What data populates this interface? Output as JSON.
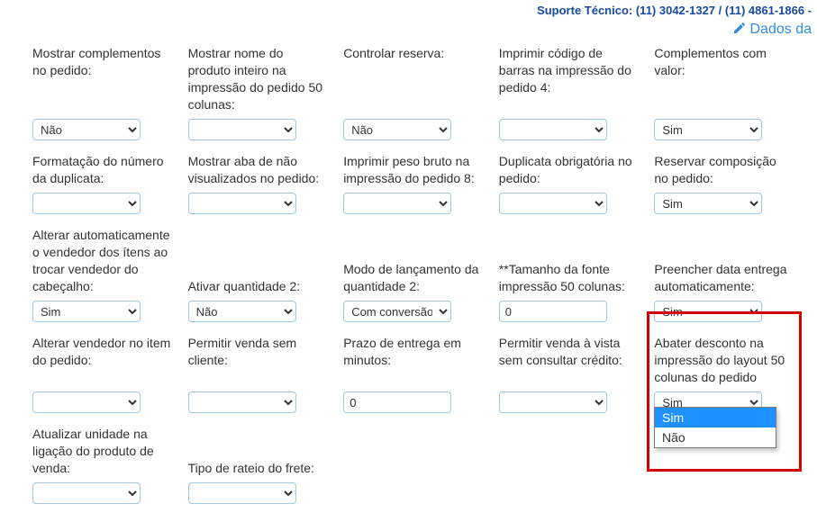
{
  "topbar": {
    "support_text": "Suporte Técnico: (11) 3042-1327 / (11) 4861-1866 -"
  },
  "editlink": {
    "text": "Dados da"
  },
  "options": {
    "sim": "Sim",
    "nao": "Não",
    "com_conversao": "Com conversão"
  },
  "dropdown_open": {
    "opt1": "Sim",
    "opt2": "Não"
  },
  "fields": {
    "r1c1": {
      "label": "Mostrar complementos no pedido:",
      "value": "Não"
    },
    "r1c2": {
      "label": "Mostrar nome do produto inteiro na impressão do pedido 50 colunas:",
      "value": ""
    },
    "r1c3": {
      "label": "Controlar reserva:",
      "value": "Não"
    },
    "r1c4": {
      "label": "Imprimir código de barras na impressão do pedido 4:",
      "value": ""
    },
    "r1c5": {
      "label": "Complementos com valor:",
      "value": "Sim"
    },
    "r2c1": {
      "label": "Formatação do número da duplicata:",
      "value": ""
    },
    "r2c2": {
      "label": "Mostrar aba de não visualizados no pedido:",
      "value": ""
    },
    "r2c3": {
      "label": "Imprimir peso bruto na impressão do pedido 8:",
      "value": ""
    },
    "r2c4": {
      "label": "Duplicata obrigatória no pedido:",
      "value": ""
    },
    "r2c5": {
      "label": "Reservar composição no pedido:",
      "value": "Sim"
    },
    "r3c1": {
      "label": "Alterar automaticamente o vendedor dos ítens ao trocar vendedor do cabeçalho:",
      "value": "Sim"
    },
    "r3c2": {
      "label": "Ativar quantidade 2:",
      "value": "Não"
    },
    "r3c3": {
      "label": "Modo de lançamento da quantidade 2:",
      "value": "Com conversão"
    },
    "r3c4": {
      "label": "**Tamanho da fonte impressão 50 colunas:",
      "value": "0"
    },
    "r3c5": {
      "label": "Preencher data entrega automaticamente:",
      "value": "Sim"
    },
    "r4c1": {
      "label": "Alterar vendedor no item do pedido:",
      "value": ""
    },
    "r4c2": {
      "label": "Permitir venda sem cliente:",
      "value": ""
    },
    "r4c3": {
      "label": "Prazo de entrega em minutos:",
      "value": "0"
    },
    "r4c4": {
      "label": "Permitir venda à vista sem consultar crédito:",
      "value": ""
    },
    "r4c5": {
      "label": "Abater desconto na impressão do layout 50 colunas do pedido",
      "value": "Sim"
    },
    "r5c1": {
      "label": "Atualizar unidade na ligação do produto de venda:",
      "value": ""
    },
    "r5c2": {
      "label": "Tipo de rateio do frete:",
      "value": ""
    }
  }
}
